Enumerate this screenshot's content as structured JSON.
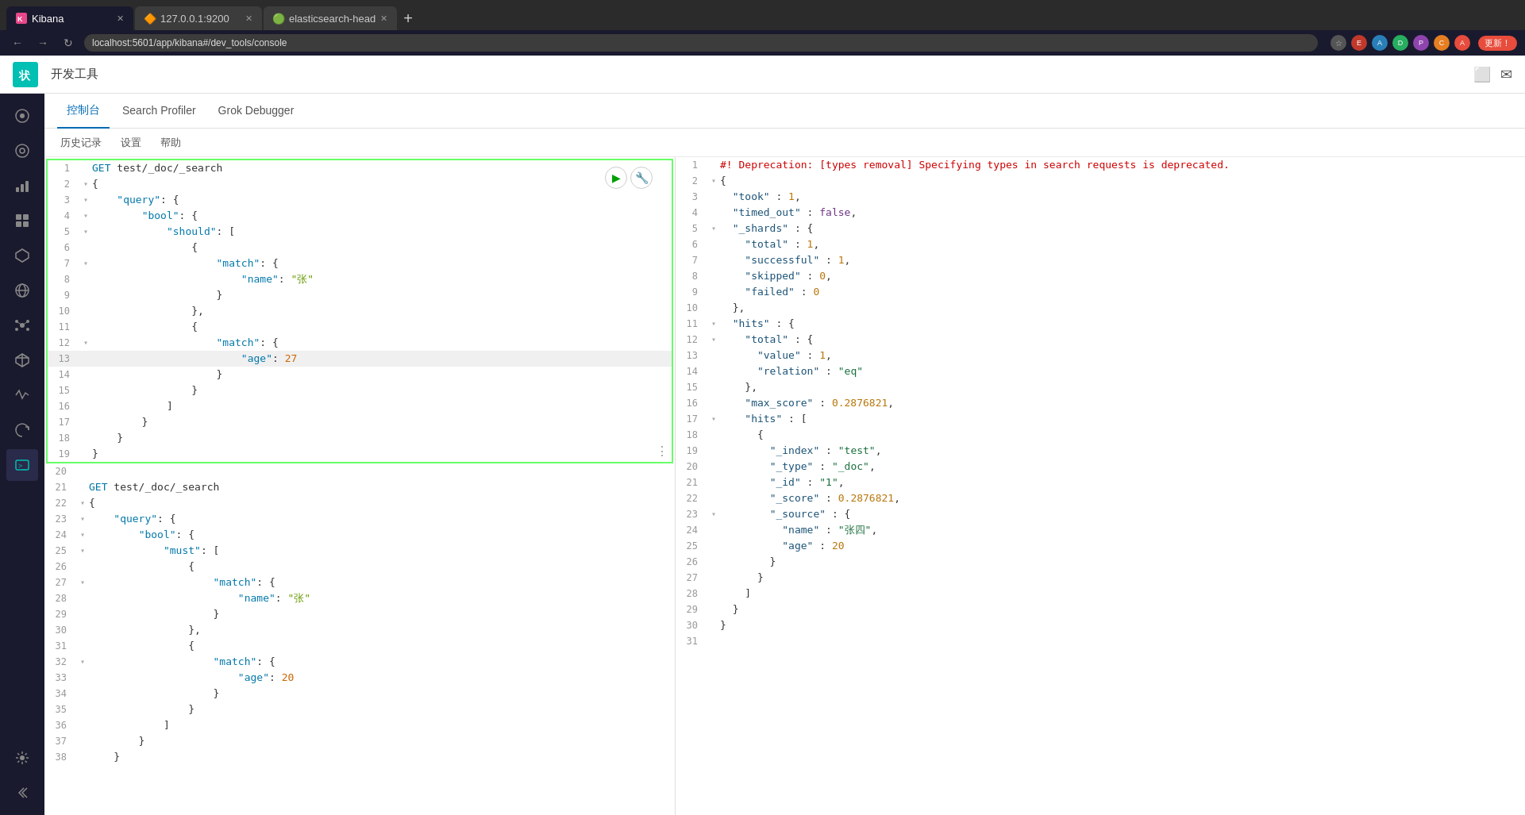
{
  "browser": {
    "tabs": [
      {
        "id": "kibana",
        "label": "Kibana",
        "active": true,
        "favicon": "🟥"
      },
      {
        "id": "elastic",
        "label": "127.0.0.1:9200",
        "active": false,
        "favicon": "🔶"
      },
      {
        "id": "es-head",
        "label": "elasticsearch-head",
        "active": false,
        "favicon": "🟢"
      }
    ],
    "url": "localhost:5601/app/kibana#/dev_tools/console",
    "update_btn": "更新！"
  },
  "topbar": {
    "logo_text": "状",
    "title": "开发工具"
  },
  "subnav": {
    "tabs": [
      {
        "id": "console",
        "label": "控制台",
        "active": true
      },
      {
        "id": "search-profiler",
        "label": "Search Profiler",
        "active": false
      },
      {
        "id": "grok-debugger",
        "label": "Grok Debugger",
        "active": false
      }
    ]
  },
  "toolbar": {
    "history": "历史记录",
    "settings": "设置",
    "help": "帮助"
  },
  "editor": {
    "lines": [
      {
        "num": 1,
        "fold": false,
        "content": "GET test/_doc/_search",
        "type": "method"
      },
      {
        "num": 2,
        "fold": true,
        "content": "{",
        "type": "punct"
      },
      {
        "num": 3,
        "fold": true,
        "content": "    \"query\": {",
        "type": "key"
      },
      {
        "num": 4,
        "fold": true,
        "content": "        \"bool\": {",
        "type": "key"
      },
      {
        "num": 5,
        "fold": true,
        "content": "            \"should\": [",
        "type": "key"
      },
      {
        "num": 6,
        "fold": false,
        "content": "                {",
        "type": "punct"
      },
      {
        "num": 7,
        "fold": true,
        "content": "                    \"match\": {",
        "type": "key"
      },
      {
        "num": 8,
        "fold": false,
        "content": "                        \"name\": \"张\"",
        "type": "keyval"
      },
      {
        "num": 9,
        "fold": false,
        "content": "                    }",
        "type": "punct"
      },
      {
        "num": 10,
        "fold": false,
        "content": "                },",
        "type": "punct"
      },
      {
        "num": 11,
        "fold": false,
        "content": "                {",
        "type": "punct"
      },
      {
        "num": 12,
        "fold": true,
        "content": "                    \"match\": {",
        "type": "key"
      },
      {
        "num": 13,
        "fold": false,
        "content": "                        \"age\": 27",
        "type": "keyval",
        "active": true
      },
      {
        "num": 14,
        "fold": false,
        "content": "                    }",
        "type": "punct"
      },
      {
        "num": 15,
        "fold": false,
        "content": "                }",
        "type": "punct"
      },
      {
        "num": 16,
        "fold": false,
        "content": "            ]",
        "type": "punct"
      },
      {
        "num": 17,
        "fold": false,
        "content": "        }",
        "type": "punct"
      },
      {
        "num": 18,
        "fold": false,
        "content": "    }",
        "type": "punct"
      },
      {
        "num": 19,
        "fold": false,
        "content": "}",
        "type": "punct"
      },
      {
        "num": 20,
        "fold": false,
        "content": "",
        "type": "empty"
      },
      {
        "num": 21,
        "fold": false,
        "content": "GET test/_doc/_search",
        "type": "method"
      },
      {
        "num": 22,
        "fold": true,
        "content": "{",
        "type": "punct"
      },
      {
        "num": 23,
        "fold": true,
        "content": "    \"query\": {",
        "type": "key"
      },
      {
        "num": 24,
        "fold": true,
        "content": "        \"bool\": {",
        "type": "key"
      },
      {
        "num": 25,
        "fold": true,
        "content": "            \"must\": [",
        "type": "key"
      },
      {
        "num": 26,
        "fold": false,
        "content": "                {",
        "type": "punct"
      },
      {
        "num": 27,
        "fold": true,
        "content": "                    \"match\": {",
        "type": "key"
      },
      {
        "num": 28,
        "fold": false,
        "content": "                        \"name\": \"张\"",
        "type": "keyval"
      },
      {
        "num": 29,
        "fold": false,
        "content": "                    }",
        "type": "punct"
      },
      {
        "num": 30,
        "fold": false,
        "content": "                },",
        "type": "punct"
      },
      {
        "num": 31,
        "fold": false,
        "content": "                {",
        "type": "punct"
      },
      {
        "num": 32,
        "fold": true,
        "content": "                    \"match\": {",
        "type": "key"
      },
      {
        "num": 33,
        "fold": false,
        "content": "                        \"age\": 20",
        "type": "keyval"
      },
      {
        "num": 34,
        "fold": false,
        "content": "                    }",
        "type": "punct"
      },
      {
        "num": 35,
        "fold": false,
        "content": "                }",
        "type": "punct"
      },
      {
        "num": 36,
        "fold": false,
        "content": "            ]",
        "type": "punct"
      },
      {
        "num": 37,
        "fold": false,
        "content": "        }",
        "type": "punct"
      },
      {
        "num": 38,
        "fold": false,
        "content": "    }",
        "type": "punct"
      }
    ]
  },
  "output": {
    "lines": [
      {
        "num": 1,
        "content": "#! Deprecation: [types removal] Specifying types in search requests is deprecated.",
        "type": "comment"
      },
      {
        "num": 2,
        "content": "{",
        "type": "punct"
      },
      {
        "num": 3,
        "content": "  \"took\" : 1,",
        "type": "key_num"
      },
      {
        "num": 4,
        "content": "  \"timed_out\" : false,",
        "type": "key_bool"
      },
      {
        "num": 5,
        "content": "  \"_shards\" : {",
        "type": "key_obj"
      },
      {
        "num": 6,
        "content": "    \"total\" : 1,",
        "type": "key_num"
      },
      {
        "num": 7,
        "content": "    \"successful\" : 1,",
        "type": "key_num"
      },
      {
        "num": 8,
        "content": "    \"skipped\" : 0,",
        "type": "key_num"
      },
      {
        "num": 9,
        "content": "    \"failed\" : 0",
        "type": "key_num"
      },
      {
        "num": 10,
        "content": "  },",
        "type": "punct"
      },
      {
        "num": 11,
        "content": "  \"hits\" : {",
        "type": "key_obj"
      },
      {
        "num": 12,
        "content": "    \"total\" : {",
        "type": "key_obj"
      },
      {
        "num": 13,
        "content": "      \"value\" : 1,",
        "type": "key_num"
      },
      {
        "num": 14,
        "content": "      \"relation\" : \"eq\"",
        "type": "key_str"
      },
      {
        "num": 15,
        "content": "    },",
        "type": "punct"
      },
      {
        "num": 16,
        "content": "    \"max_score\" : 0.2876821,",
        "type": "key_num"
      },
      {
        "num": 17,
        "content": "    \"hits\" : [",
        "type": "key_arr"
      },
      {
        "num": 18,
        "content": "      {",
        "type": "punct"
      },
      {
        "num": 19,
        "content": "        \"_index\" : \"test\",",
        "type": "key_str"
      },
      {
        "num": 20,
        "content": "        \"_type\" : \"_doc\",",
        "type": "key_str"
      },
      {
        "num": 21,
        "content": "        \"_id\" : \"1\",",
        "type": "key_str"
      },
      {
        "num": 22,
        "content": "        \"_score\" : 0.2876821,",
        "type": "key_num"
      },
      {
        "num": 23,
        "content": "        \"_source\" : {",
        "type": "key_obj"
      },
      {
        "num": 24,
        "content": "          \"name\" : \"张四\",",
        "type": "key_str"
      },
      {
        "num": 25,
        "content": "          \"age\" : 20",
        "type": "key_num"
      },
      {
        "num": 26,
        "content": "        }",
        "type": "punct"
      },
      {
        "num": 27,
        "content": "      }",
        "type": "punct"
      },
      {
        "num": 28,
        "content": "    ]",
        "type": "punct"
      },
      {
        "num": 29,
        "content": "  }",
        "type": "punct"
      },
      {
        "num": 30,
        "content": "}",
        "type": "punct"
      },
      {
        "num": 31,
        "content": "",
        "type": "empty"
      }
    ]
  },
  "sidebar": {
    "items": [
      {
        "id": "home",
        "icon": "⊞",
        "label": "Home"
      },
      {
        "id": "discover",
        "icon": "◎",
        "label": "Discover"
      },
      {
        "id": "visualize",
        "icon": "📊",
        "label": "Visualize"
      },
      {
        "id": "dashboard",
        "icon": "▦",
        "label": "Dashboard"
      },
      {
        "id": "canvas",
        "icon": "⬡",
        "label": "Canvas"
      },
      {
        "id": "maps",
        "icon": "⊕",
        "label": "Maps"
      },
      {
        "id": "ml",
        "icon": "⊛",
        "label": "Machine Learning"
      },
      {
        "id": "graph",
        "icon": "⬡",
        "label": "Graph"
      },
      {
        "id": "apm",
        "icon": "△",
        "label": "APM"
      },
      {
        "id": "uptime",
        "icon": "♡",
        "label": "Uptime"
      },
      {
        "id": "devtools",
        "icon": "⌨",
        "label": "Dev Tools",
        "active": true
      },
      {
        "id": "monitoring",
        "icon": "⊞",
        "label": "Stack Monitoring"
      },
      {
        "id": "collapse",
        "icon": "≫",
        "label": "Collapse"
      }
    ]
  }
}
